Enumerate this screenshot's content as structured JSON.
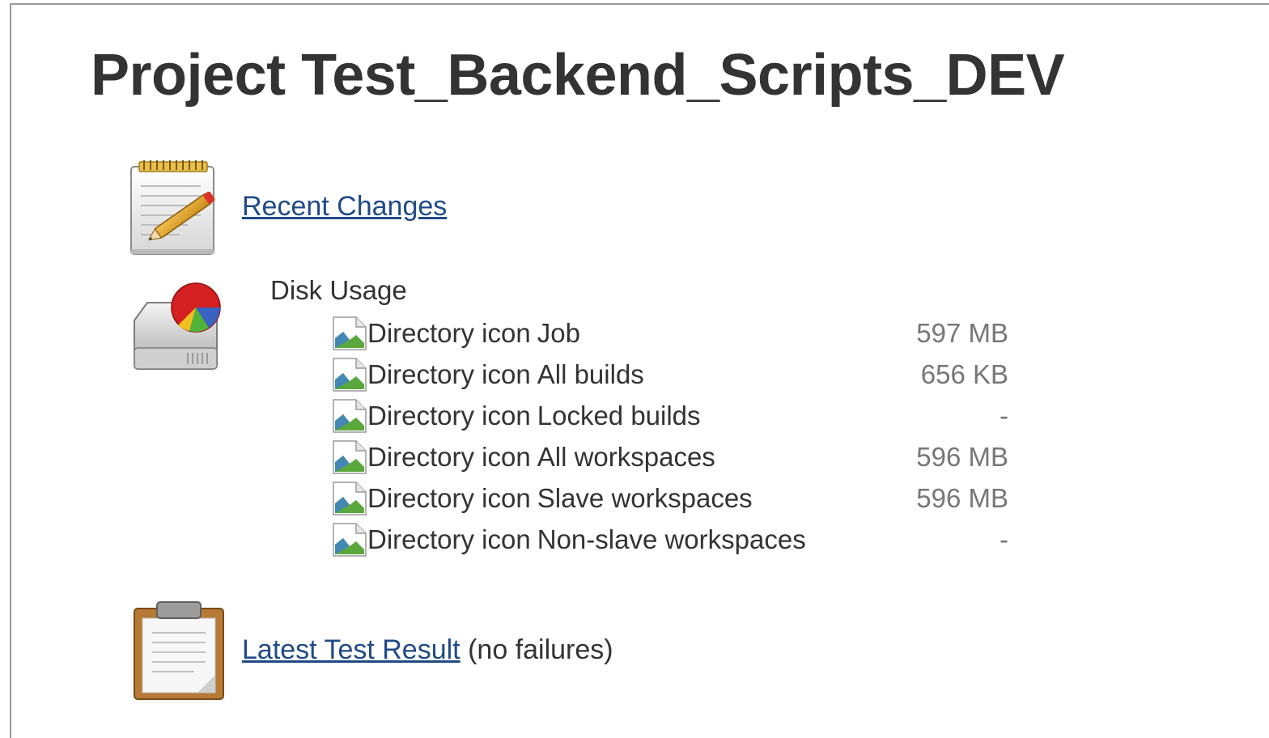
{
  "project": {
    "title": "Project Test_Backend_Scripts_DEV"
  },
  "recent_changes": {
    "icon": "notepad-icon",
    "label": "Recent Changes"
  },
  "disk_usage": {
    "icon": "disk-usage-icon",
    "title": "Disk Usage",
    "dir_icon_alt": "Directory icon",
    "rows": [
      {
        "name": "Job",
        "size": "597 MB"
      },
      {
        "name": "All builds",
        "size": "656 KB"
      },
      {
        "name": "Locked builds",
        "size": "-"
      },
      {
        "name": "All workspaces",
        "size": "596 MB"
      },
      {
        "name": "Slave workspaces",
        "size": "596 MB"
      },
      {
        "name": "Non-slave workspaces",
        "size": "-"
      }
    ]
  },
  "test_result": {
    "icon": "clipboard-icon",
    "link_label": "Latest Test Result",
    "status": "(no failures)"
  },
  "colors": {
    "link": "#204a87",
    "text": "#333333",
    "muted": "#777777"
  }
}
